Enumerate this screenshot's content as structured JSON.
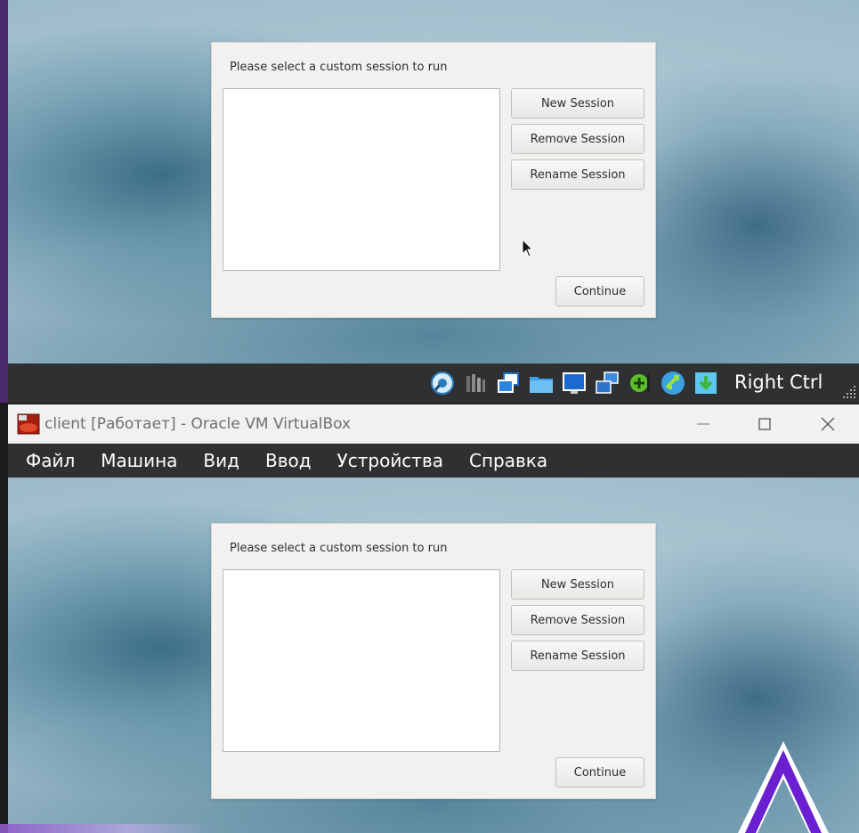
{
  "top_vm": {
    "dialog": {
      "prompt": "Please select a custom session to run",
      "buttons": {
        "new": "New Session",
        "remove": "Remove Session",
        "rename": "Rename Session",
        "continue": "Continue"
      }
    },
    "statusbar": {
      "icons": [
        "hard-disk-icon",
        "audio-icon",
        "network-icon",
        "shared-folders-icon",
        "display-icon",
        "video-capture-icon",
        "usb-icon",
        "mouse-integration-icon",
        "download-icon"
      ],
      "host_key": "Right Ctrl"
    }
  },
  "vbox_window": {
    "title": "client [Работает] - Oracle VM VirtualBox",
    "menu": [
      "Файл",
      "Машина",
      "Вид",
      "Ввод",
      "Устройства",
      "Справка"
    ],
    "dialog": {
      "prompt": "Please select a custom session to run",
      "buttons": {
        "new": "New Session",
        "remove": "Remove Session",
        "rename": "Rename Session",
        "continue": "Continue"
      }
    }
  },
  "colors": {
    "statusbar_bg": "#2f3032",
    "menubar_bg": "#2f3032",
    "titlebar_bg": "#f1f1f1",
    "dialog_bg": "#f2f1ef",
    "accent_purple": "#6a1fd1"
  }
}
